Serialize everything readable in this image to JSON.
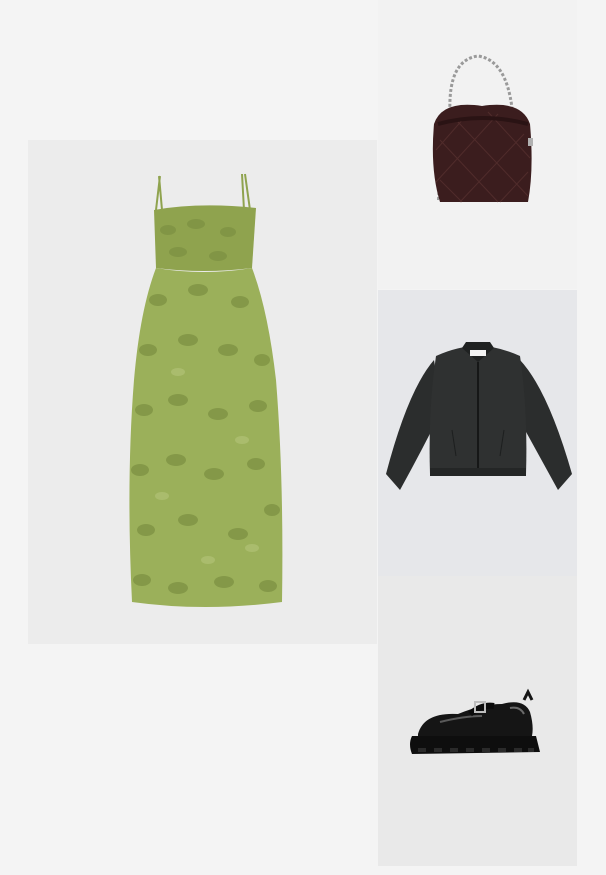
{
  "collage": {
    "items": [
      {
        "id": "dress",
        "icon": "green-floral-midi-dress-icon",
        "color": "#8fa34e"
      },
      {
        "id": "bag",
        "icon": "burgundy-quilted-shoulder-bag-icon",
        "color": "#3b1d1e"
      },
      {
        "id": "jacket",
        "icon": "black-zip-jacket-icon",
        "color": "#2a2c2c"
      },
      {
        "id": "shoe",
        "icon": "black-patent-buckle-loafer-icon",
        "color": "#151515"
      }
    ]
  }
}
